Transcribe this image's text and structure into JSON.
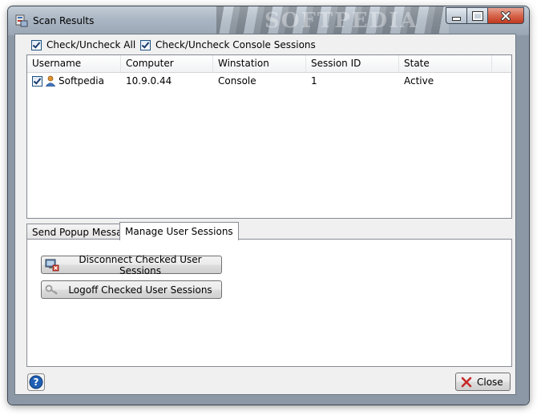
{
  "window": {
    "title": "Scan Results",
    "title_watermark": "SOFTPEDIA"
  },
  "options": {
    "check_all_label": "Check/Uncheck All",
    "check_console_label": "Check/Uncheck Console Sessions"
  },
  "sessions": {
    "columns": [
      "Username",
      "Computer",
      "Winstation",
      "Session ID",
      "State"
    ],
    "rows": [
      {
        "checked": true,
        "username": "Softpedia",
        "computer": "10.9.0.44",
        "winstation": "Console",
        "session_id": "1",
        "state": "Active"
      }
    ]
  },
  "tabs": [
    {
      "label": "Send Popup Message",
      "active": false
    },
    {
      "label": "Manage User Sessions",
      "active": true
    }
  ],
  "actions": {
    "disconnect_label": "Disconnect Checked User Sessions",
    "logoff_label": "Logoff Checked User Sessions"
  },
  "footer": {
    "close_label": "Close"
  },
  "icons": {
    "app": "app-icon",
    "user": "user-icon",
    "disconnect": "disconnect-icon",
    "logoff": "key-icon",
    "help": "help-icon",
    "close": "close-x-icon"
  },
  "colors": {
    "title_close_red": "#c1391f",
    "help_blue": "#1e5fb4",
    "user_orange": "#e0922f"
  }
}
